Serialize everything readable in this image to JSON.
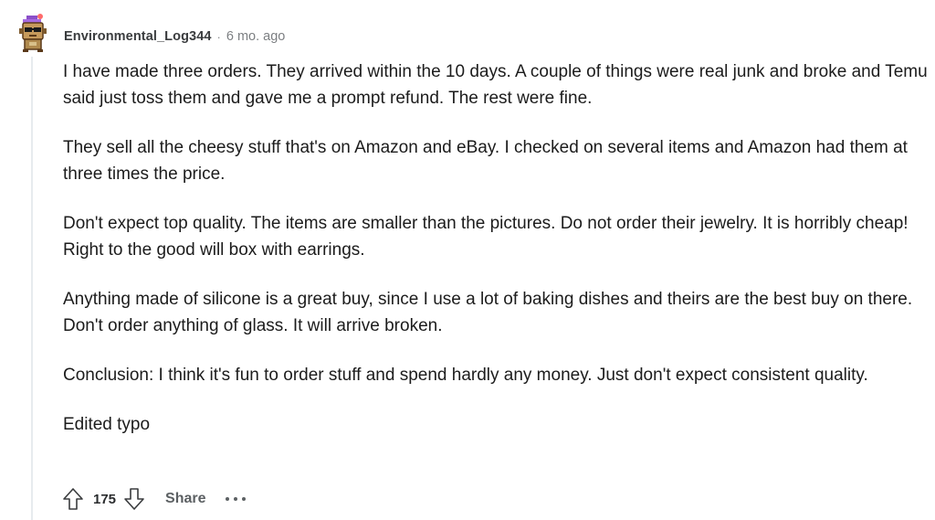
{
  "comment": {
    "username": "Environmental_Log344",
    "separator": "·",
    "timestamp": "6 mo. ago",
    "avatar_icon": "robot-snoo-avatar-icon",
    "paragraphs": [
      "I have made three orders. They arrived within the 10 days. A couple of things were real junk and broke and Temu said just toss them and gave me a prompt refund. The rest were fine.",
      "They sell all the cheesy stuff that's on Amazon and eBay. I checked on several items and Amazon had them at three times the price.",
      "Don't expect top quality. The items are smaller than the pictures. Do not order their jewelry. It is horribly cheap! Right to the good will box with earrings.",
      "Anything made of silicone is a great buy, since I use a lot of baking dishes and theirs are the best buy on there. Don't order anything of glass. It will arrive broken.",
      "Conclusion: I think it's fun to order stuff and spend hardly any money. Just don't expect consistent quality.",
      "Edited typo"
    ]
  },
  "actions": {
    "upvote_icon": "upvote-arrow-icon",
    "score": "175",
    "downvote_icon": "downvote-arrow-icon",
    "share_label": "Share",
    "more_icon": "more-options-icon"
  },
  "colors": {
    "text": "#1c1c1c",
    "meta": "#7c7f82",
    "thread_line": "#e7ebee",
    "action": "#5c6063"
  }
}
